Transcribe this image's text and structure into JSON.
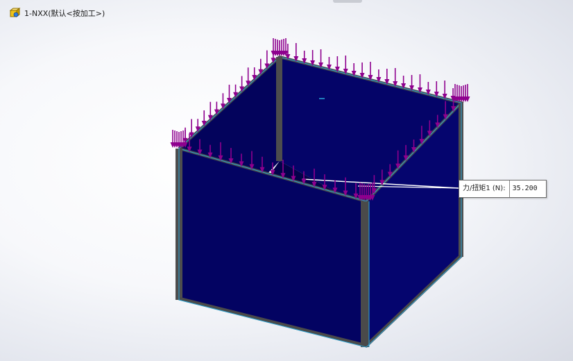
{
  "study": {
    "icon": "static-study-icon",
    "title": "1-NXX(默认<按加工>)"
  },
  "callout": {
    "label": "力/扭矩1 (N):",
    "value": "35.200"
  },
  "model": {
    "face_color": "#03035c",
    "edge_color": "#5b5b5b",
    "outline_color": "#2aa6d8",
    "load_arrow_color": "#8e008e"
  }
}
